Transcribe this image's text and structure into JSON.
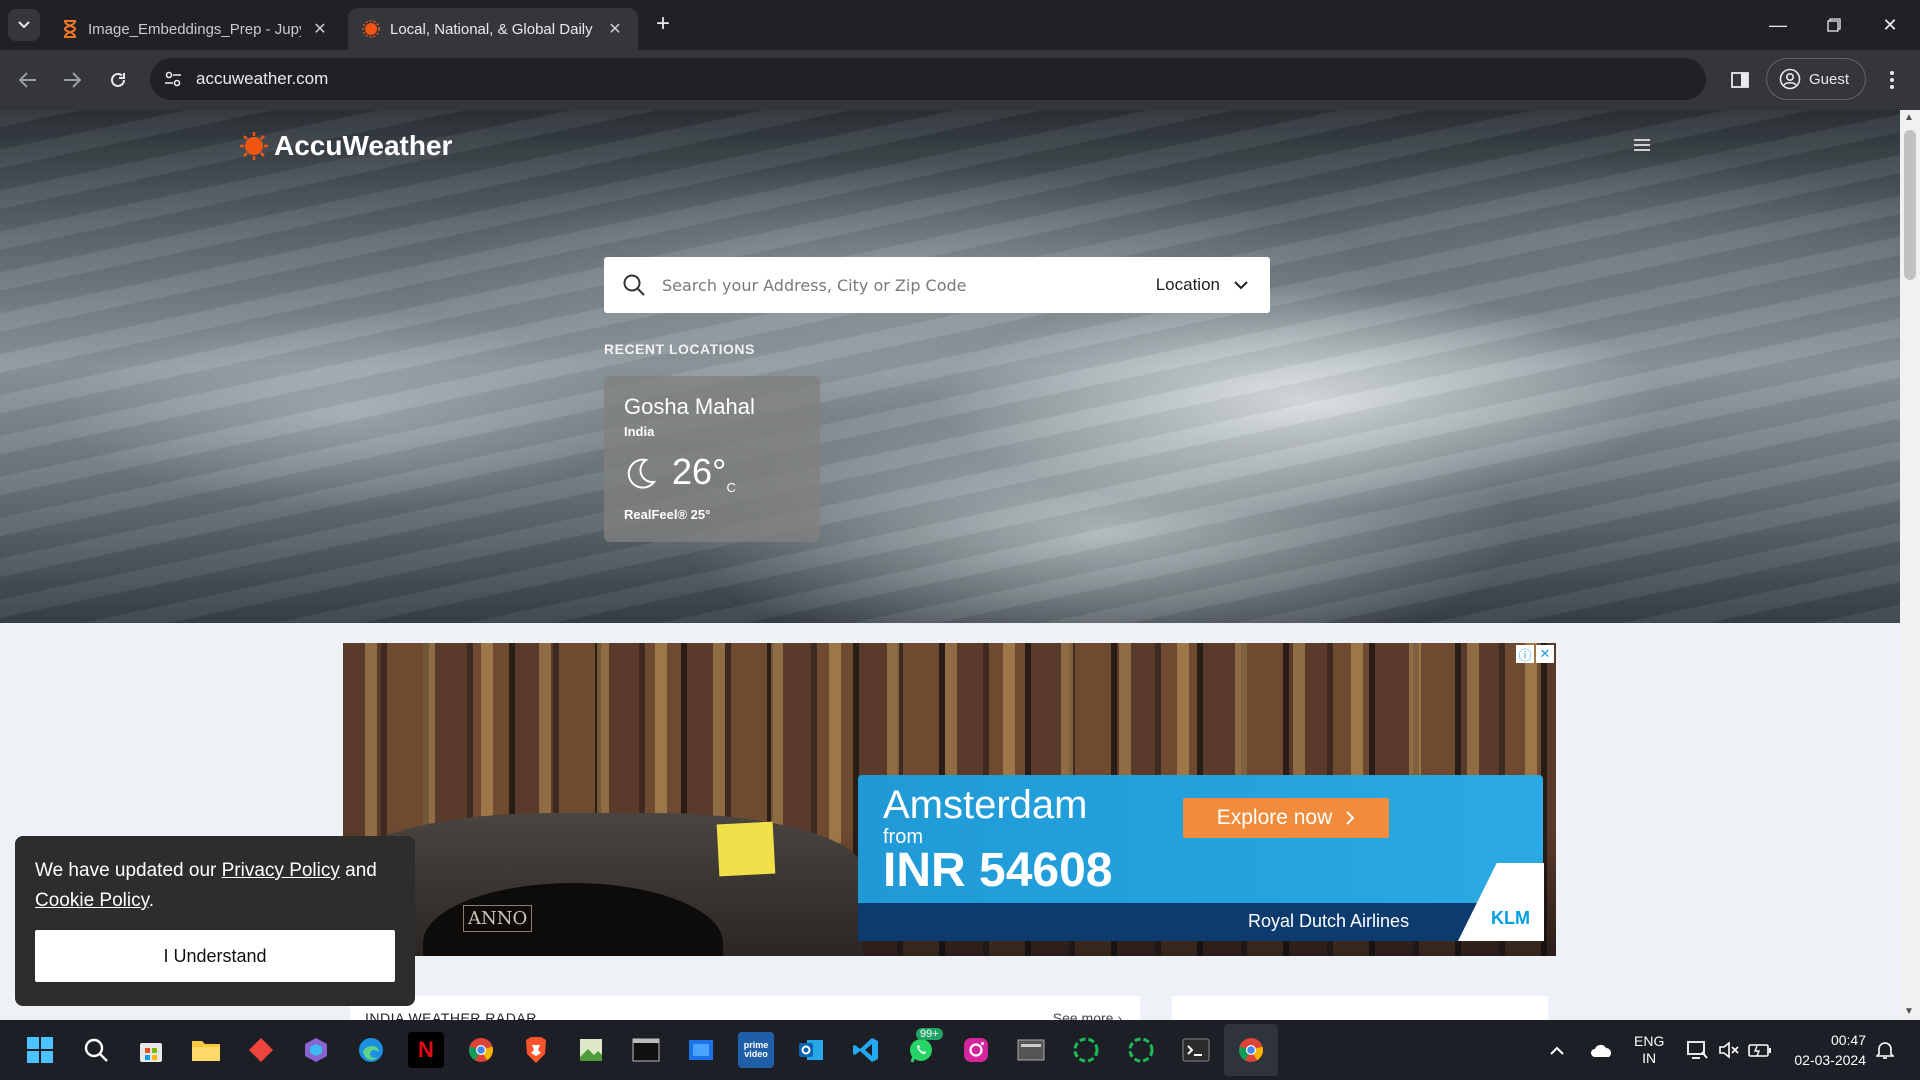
{
  "browser": {
    "tabs": [
      {
        "title": "Image_Embeddings_Prep - Jupy",
        "active": false
      },
      {
        "title": "Local, National, & Global Daily W",
        "active": true
      }
    ],
    "url": "accuweather.com",
    "profile_label": "Guest"
  },
  "site": {
    "logo_text": "AccuWeather",
    "search_placeholder": "Search your Address, City or Zip Code",
    "location_label": "Location",
    "recent_label": "RECENT LOCATIONS",
    "recent": {
      "city": "Gosha Mahal",
      "country": "India",
      "temp": "26°",
      "unit": "C",
      "realfeel": "RealFeel® 25°"
    }
  },
  "ad": {
    "destination": "Amsterdam",
    "from": "from",
    "price": "INR 54608",
    "cta": "Explore now",
    "airline": "Royal Dutch Airlines",
    "brand": "KLM",
    "sign": "ANNO"
  },
  "cards": {
    "left_title": "INDIA WEATHER RADAR",
    "left_more": "See more"
  },
  "cookie": {
    "text_prefix": "We have updated our",
    "privacy_link": "Privacy Policy",
    "and": "and",
    "cookie_link": "Cookie Policy",
    "period": ".",
    "button": "I Understand"
  },
  "taskbar": {
    "lang_top": "ENG",
    "lang_bottom": "IN",
    "time": "00:47",
    "date": "02-03-2024",
    "whatsapp_badge": "99+"
  },
  "colors": {
    "accent_orange": "#f05514",
    "chrome_bg": "#202124",
    "ad_blue": "#1f9ad6",
    "ad_cta": "#f08c3c"
  }
}
